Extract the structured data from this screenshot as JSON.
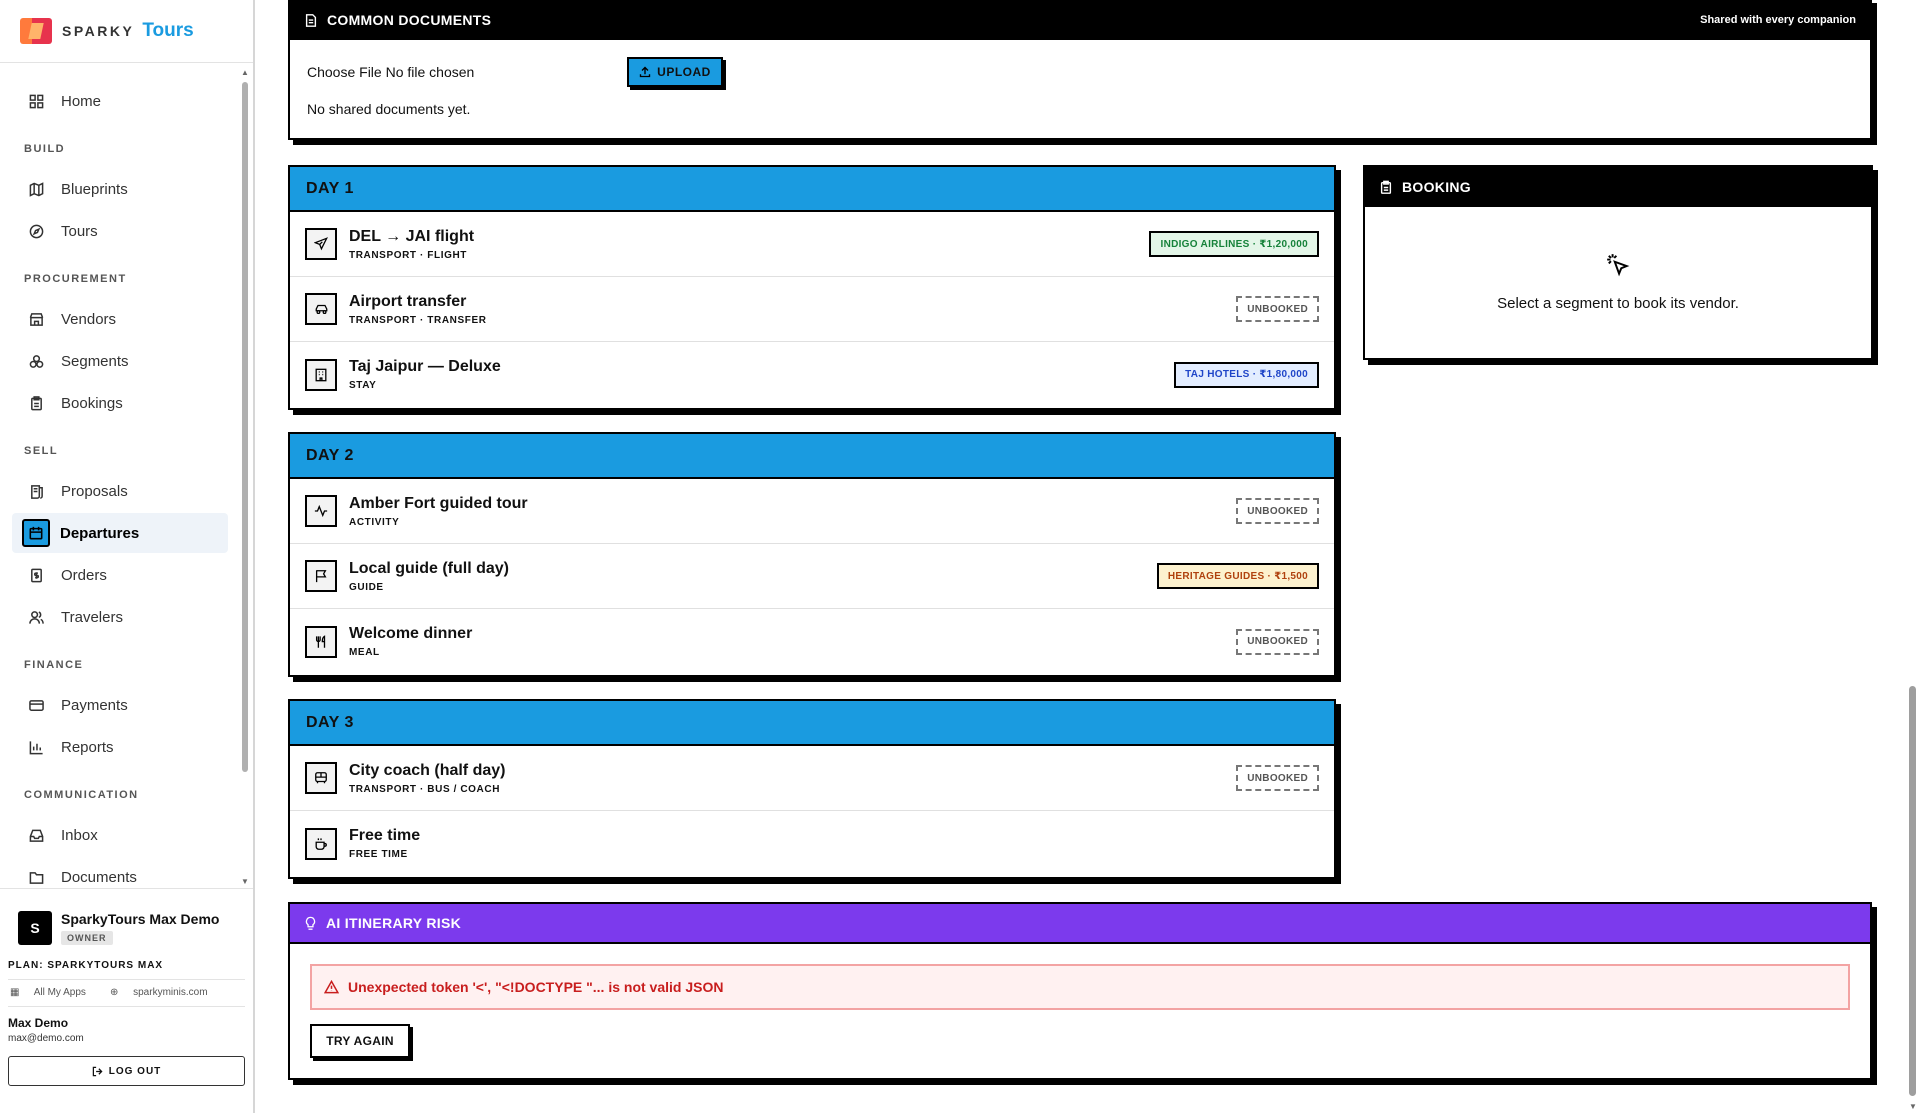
{
  "brand": {
    "name": "SPARKY",
    "product": "Tours"
  },
  "nav": {
    "home": "Home",
    "groups": {
      "build": "BUILD",
      "procurement": "PROCUREMENT",
      "sell": "SELL",
      "finance": "FINANCE",
      "communication": "COMMUNICATION"
    },
    "items": {
      "blueprints": "Blueprints",
      "tours": "Tours",
      "vendors": "Vendors",
      "segments": "Segments",
      "bookings": "Bookings",
      "proposals": "Proposals",
      "departures": "Departures",
      "orders": "Orders",
      "travelers": "Travelers",
      "payments": "Payments",
      "reports": "Reports",
      "inbox": "Inbox",
      "documents": "Documents"
    },
    "active": "departures"
  },
  "footer": {
    "org_initial": "S",
    "org_name": "SparkyTours Max Demo",
    "role": "OWNER",
    "plan": "PLAN: SPARKYTOURS MAX",
    "link_apps": "All My Apps",
    "link_site": "sparkyminis.com",
    "user_name": "Max Demo",
    "user_email": "max@demo.com",
    "logout": "LOG OUT"
  },
  "docs": {
    "title": "COMMON DOCUMENTS",
    "shared_note": "Shared with every companion",
    "file_label": "Choose File No file chosen",
    "upload": "UPLOAD",
    "empty": "No shared documents yet."
  },
  "days": [
    {
      "label": "DAY 1",
      "segments": [
        {
          "title": "DEL → JAI flight",
          "sub": "TRANSPORT · FLIGHT",
          "icon": "plane-icon",
          "badge": "INDIGO AIRLINES · ₹1,20,000",
          "badge_color": "green"
        },
        {
          "title": "Airport transfer",
          "sub": "TRANSPORT · TRANSFER",
          "icon": "car-icon",
          "badge": "UNBOOKED",
          "badge_color": "unbooked"
        },
        {
          "title": "Taj Jaipur — Deluxe",
          "sub": "STAY",
          "icon": "hotel-icon",
          "badge": "TAJ HOTELS · ₹1,80,000",
          "badge_color": "blue"
        }
      ]
    },
    {
      "label": "DAY 2",
      "segments": [
        {
          "title": "Amber Fort guided tour",
          "sub": "ACTIVITY",
          "icon": "activity-icon",
          "badge": "UNBOOKED",
          "badge_color": "unbooked"
        },
        {
          "title": "Local guide (full day)",
          "sub": "GUIDE",
          "icon": "flag-icon",
          "badge": "HERITAGE GUIDES · ₹1,500",
          "badge_color": "yellow"
        },
        {
          "title": "Welcome dinner",
          "sub": "MEAL",
          "icon": "utensils-icon",
          "badge": "UNBOOKED",
          "badge_color": "unbooked"
        }
      ]
    },
    {
      "label": "DAY 3",
      "segments": [
        {
          "title": "City coach (half day)",
          "sub": "TRANSPORT · BUS / COACH",
          "icon": "bus-icon",
          "badge": "UNBOOKED",
          "badge_color": "unbooked"
        },
        {
          "title": "Free time",
          "sub": "FREE TIME",
          "icon": "coffee-icon",
          "badge": "",
          "badge_color": ""
        }
      ]
    }
  ],
  "booking": {
    "title": "BOOKING",
    "message": "Select a segment to book its vendor."
  },
  "risk": {
    "title": "AI ITINERARY RISK",
    "error": "Unexpected token '<', \"<!DOCTYPE \"... is not valid JSON",
    "retry": "TRY AGAIN"
  },
  "colors": {
    "accent_blue": "#1a9be0",
    "risk_purple": "#7c3aed",
    "error_red": "#c81e1e"
  }
}
